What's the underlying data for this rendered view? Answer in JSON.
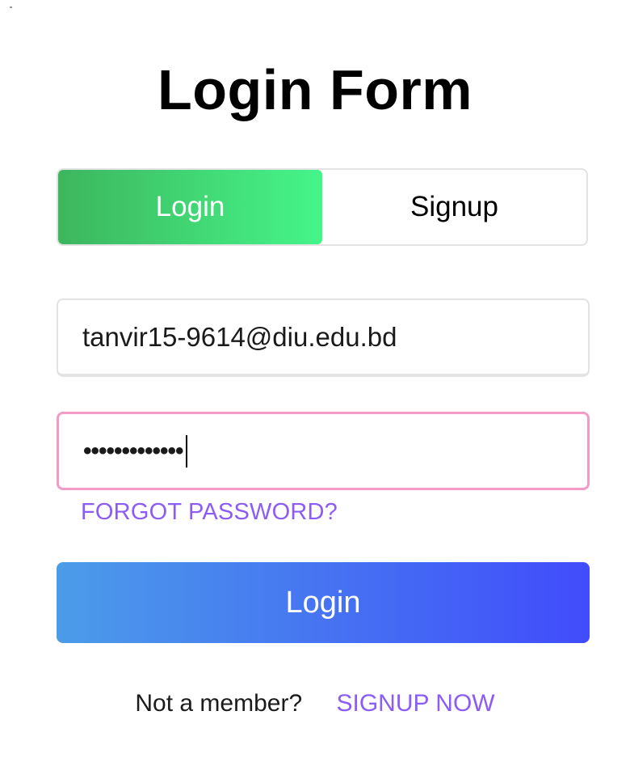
{
  "title": "Login Form",
  "tabs": [
    {
      "label": "Login",
      "active": true
    },
    {
      "label": "Signup",
      "active": false
    }
  ],
  "form": {
    "email_value": "tanvir15-9614@diu.edu.bd",
    "password_masked": "•••••••••••••",
    "forgot_label": "FORGOT PASSWORD?",
    "submit_label": "Login"
  },
  "footer": {
    "prompt": "Not a member?",
    "signup_link": "SIGNUP NOW"
  },
  "colors": {
    "login_tab_gradient": [
      "#3db65e",
      "#45f58a"
    ],
    "submit_gradient": [
      "#4b9ce9",
      "#414cfb"
    ],
    "link_color": "#8b5cf6",
    "password_focus_border": "#f39bc6"
  }
}
